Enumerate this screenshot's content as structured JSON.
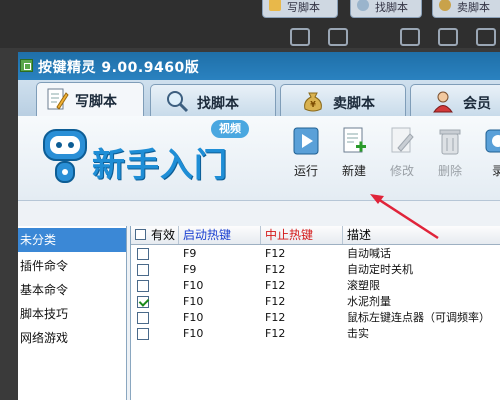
{
  "background": {
    "tabs": [
      {
        "label": "写脚本"
      },
      {
        "label": "找脚本"
      },
      {
        "label": "卖脚本"
      }
    ]
  },
  "window": {
    "title": "按键精灵 9.00.9460版",
    "tabs": [
      {
        "label": "写脚本",
        "icon": "pencil-icon",
        "active": true
      },
      {
        "label": "找脚本",
        "icon": "magnifier-icon",
        "active": false
      },
      {
        "label": "卖脚本",
        "icon": "money-bag-icon",
        "active": false
      },
      {
        "label": "会员",
        "icon": "member-icon",
        "active": false
      }
    ]
  },
  "banner": {
    "brand": "新手入门",
    "video_badge": "视频"
  },
  "toolbar": {
    "run": "运行",
    "new": "新建",
    "edit": "修改",
    "delete": "删除",
    "record": "录"
  },
  "categories": [
    {
      "label": "未分类",
      "selected": true
    },
    {
      "label": "插件命令",
      "selected": false
    },
    {
      "label": "基本命令",
      "selected": false
    },
    {
      "label": "脚本技巧",
      "selected": false
    },
    {
      "label": "网络游戏",
      "selected": false
    }
  ],
  "table": {
    "headers": {
      "enabled": "有效",
      "start_hotkey": "启动热键",
      "stop_hotkey": "中止热键",
      "description": "描述"
    },
    "rows": [
      {
        "checked": false,
        "start": "F9",
        "stop": "F12",
        "desc": "自动喊话"
      },
      {
        "checked": false,
        "start": "F9",
        "stop": "F12",
        "desc": "自动定时关机"
      },
      {
        "checked": false,
        "start": "F10",
        "stop": "F12",
        "desc": "滚塑限"
      },
      {
        "checked": true,
        "start": "F10",
        "stop": "F12",
        "desc": "水泥剂量"
      },
      {
        "checked": false,
        "start": "F10",
        "stop": "F12",
        "desc": "鼠标左键连点器（可调频率）"
      },
      {
        "checked": false,
        "start": "F10",
        "stop": "F12",
        "desc": "击实"
      }
    ]
  },
  "colors": {
    "titlebar": "#2a82c0",
    "selected_category": "#3b88d6",
    "start_hotkey_header": "#1a3fd1",
    "stop_hotkey_header": "#d41a1a",
    "annotation_arrow": "#e0243a"
  }
}
